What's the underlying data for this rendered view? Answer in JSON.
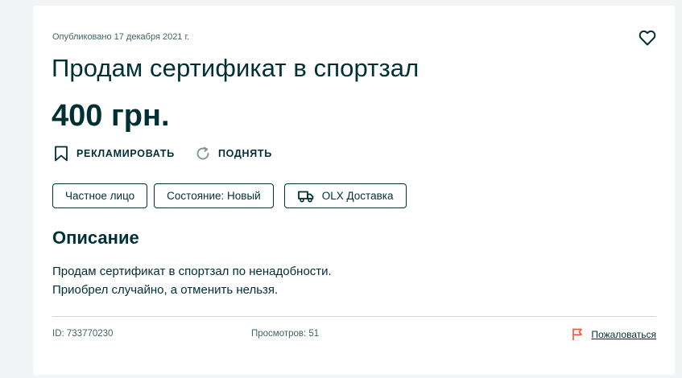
{
  "ad": {
    "published": "Опубликовано 17 декабря 2021 г.",
    "title": "Продам сертификат в спортзал",
    "price": "400 грн."
  },
  "actions": {
    "promote_label": "РЕКЛАМИРОВАТЬ",
    "raise_label": "ПОДНЯТЬ"
  },
  "tags": {
    "seller_type": "Частное лицо",
    "condition": "Состояние: Новый",
    "delivery": "OLX Доставка"
  },
  "description": {
    "heading": "Описание",
    "line1": "Продам сертификат в спортзал по ненадобности.",
    "line2": "Приобрел случайно, а отменить нельзя."
  },
  "footer": {
    "id_text": "ID: 733770230",
    "views_text": "Просмотров: 51",
    "report_label": "Пожаловаться"
  },
  "icons": {
    "favorite": "heart-outline-icon",
    "promote": "bookmark-outline-icon",
    "raise": "refresh-icon",
    "delivery": "truck-icon",
    "report": "flag-icon"
  },
  "colors": {
    "text": "#002f34",
    "muted": "#406367",
    "report_flag": "#ff5636",
    "background": "#f2f4f5",
    "card": "#ffffff"
  }
}
